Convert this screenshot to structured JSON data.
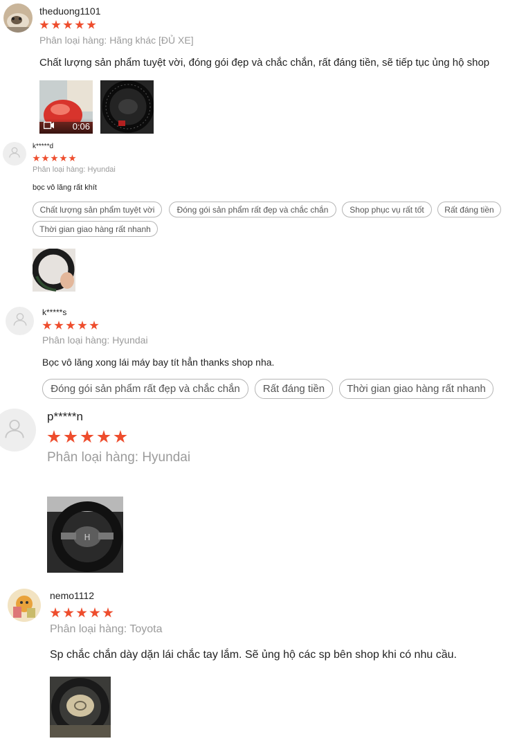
{
  "reviews": [
    {
      "username": "theduong1101",
      "rating": 5,
      "variant": "Phân loại hàng: Hãng khác [ĐỦ XE]",
      "comment": "Chất lượng sản phẩm tuyệt vời, đóng gói đẹp và chắc chắn, rất đáng tiền, sẽ tiếp tục ủng hộ shop",
      "tags": [],
      "video_duration": "0:06"
    },
    {
      "username": "k*****d",
      "rating": 5,
      "variant": "Phân loại hàng: Hyundai",
      "comment": "bọc vô lăng rất khít",
      "tags": [
        "Chất lượng sản phẩm tuyệt vời",
        "Đóng gói sản phẩm rất đẹp và chắc chắn",
        "Shop phục vụ rất tốt",
        "Rất đáng tiền",
        "Thời gian giao hàng rất nhanh"
      ]
    },
    {
      "username": "k*****s",
      "rating": 5,
      "variant": "Phân loại hàng: Hyundai",
      "comment": "Bọc vô lăng xong lái máy bay tít hẳn thanks shop nha.",
      "tags": [
        "Đóng gói sản phẩm rất đẹp và chắc chắn",
        "Rất đáng tiền",
        "Thời gian giao hàng rất nhanh"
      ]
    },
    {
      "username": "p*****n",
      "rating": 5,
      "variant": "Phân loại hàng: Hyundai",
      "comment": "",
      "tags": []
    },
    {
      "username": "nemo1112",
      "rating": 5,
      "variant": "Phân loại hàng: Toyota",
      "comment": "Sp chắc chắn dày dặn lái chắc tay lắm. Sẽ ủng hộ các sp bên shop khi có nhu cầu.",
      "tags": []
    }
  ],
  "colors": {
    "star": "#ee4d2d",
    "variant_text": "#9b9b9b",
    "tag_border": "#b5b5b5"
  },
  "icons": {
    "video": "video-camera-icon",
    "default_avatar": "user-silhouette-icon"
  }
}
